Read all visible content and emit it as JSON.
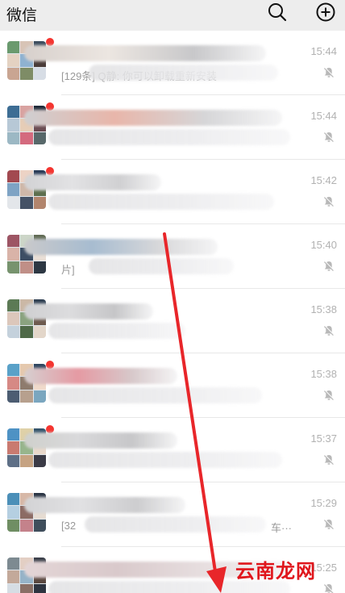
{
  "header": {
    "title": "微信",
    "search_icon": "search-icon",
    "add_icon": "plus-circle-icon"
  },
  "chats": [
    {
      "preview": "[129条] Q静: 你可以卸载重新安装",
      "time": "15:44",
      "unread": true,
      "muted": true
    },
    {
      "preview": "",
      "time": "15:44",
      "unread": true,
      "muted": true
    },
    {
      "preview": "",
      "time": "15:42",
      "unread": true,
      "muted": true
    },
    {
      "preview": "片]",
      "time": "15:40",
      "unread": false,
      "muted": true
    },
    {
      "preview": "",
      "time": "15:38",
      "unread": false,
      "muted": true
    },
    {
      "preview": "",
      "time": "15:38",
      "unread": true,
      "muted": true
    },
    {
      "preview": "",
      "time": "15:37",
      "unread": true,
      "muted": true
    },
    {
      "preview": "[32",
      "time": "15:29",
      "unread": false,
      "muted": true
    },
    {
      "preview": "",
      "time": "15:25",
      "unread": false,
      "muted": true
    }
  ],
  "preview_tail_row8": "车···",
  "watermark": "云南龙网",
  "colors": {
    "header_bg": "#ededed",
    "unread_dot": "#f43530",
    "annotation_arrow": "#e8262a",
    "watermark": "#e0161c"
  }
}
